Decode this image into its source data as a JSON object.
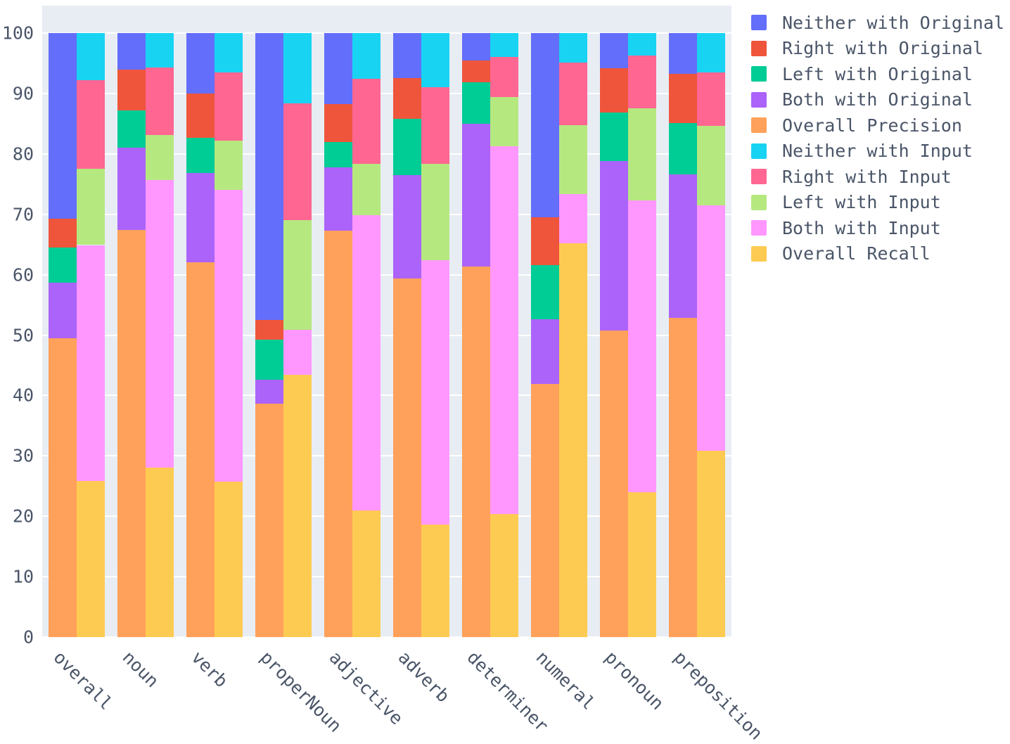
{
  "chart_data": {
    "type": "bar",
    "bar_mode": "stacked-grouped",
    "title": "",
    "xlabel": "",
    "ylabel": "",
    "ylim": [
      0,
      100
    ],
    "ytick_labels": [
      "0",
      "10",
      "20",
      "30",
      "40",
      "50",
      "60",
      "70",
      "80",
      "90",
      "100"
    ],
    "ytick_values": [
      0,
      10,
      20,
      30,
      40,
      50,
      60,
      70,
      80,
      90,
      100
    ],
    "grid": true,
    "legend_position": "right",
    "categories": [
      "overall",
      "noun",
      "verb",
      "properNoun",
      "adjective",
      "adverb",
      "determiner",
      "numeral",
      "pronoun",
      "preposition"
    ],
    "bar_groups": [
      {
        "name": "Original",
        "base_series": "Overall Precision"
      },
      {
        "name": "Input",
        "base_series": "Overall Recall"
      }
    ],
    "series": [
      {
        "name": "Neither with Original",
        "color": "#636efa",
        "stack": "Original",
        "values": [
          30.7,
          6.0,
          10.0,
          47.5,
          11.7,
          7.5,
          4.5,
          30.5,
          5.8,
          6.8
        ]
      },
      {
        "name": "Right with Original",
        "color": "#ef553b",
        "stack": "Original",
        "values": [
          4.8,
          6.8,
          7.4,
          3.3,
          6.4,
          6.7,
          3.6,
          7.9,
          7.3,
          8.1
        ]
      },
      {
        "name": "Left with Original",
        "color": "#00cc96",
        "stack": "Original",
        "values": [
          5.8,
          6.2,
          5.8,
          6.6,
          4.1,
          9.3,
          6.9,
          9.0,
          8.1,
          8.5
        ]
      },
      {
        "name": "Both with Original",
        "color": "#ab63fa",
        "stack": "Original",
        "values": [
          9.2,
          13.6,
          14.7,
          4.0,
          10.5,
          17.1,
          23.6,
          10.7,
          28.0,
          23.7
        ]
      },
      {
        "name": "Overall Precision",
        "color": "#ffa15a",
        "stack": "Original",
        "values": [
          49.5,
          67.4,
          62.1,
          38.6,
          67.3,
          59.4,
          61.4,
          41.9,
          50.8,
          52.9
        ]
      },
      {
        "name": "Neither with Input",
        "color": "#19d3f3",
        "stack": "Input",
        "values": [
          7.8,
          5.7,
          6.5,
          11.6,
          7.6,
          9.0,
          3.9,
          4.9,
          3.7,
          6.5
        ]
      },
      {
        "name": "Right with Input",
        "color": "#ff6692",
        "stack": "Input",
        "values": [
          14.7,
          11.2,
          11.3,
          19.4,
          14.0,
          12.7,
          6.7,
          10.3,
          8.8,
          8.9
        ]
      },
      {
        "name": "Left with Input",
        "color": "#b6e880",
        "stack": "Input",
        "values": [
          12.6,
          7.4,
          8.2,
          18.1,
          8.6,
          15.9,
          8.2,
          11.5,
          15.2,
          13.1
        ]
      },
      {
        "name": "Both with Input",
        "color": "#ff97ff",
        "stack": "Input",
        "values": [
          39.1,
          47.6,
          48.3,
          7.5,
          48.9,
          43.8,
          60.8,
          8.1,
          48.3,
          40.6
        ]
      },
      {
        "name": "Overall Recall",
        "color": "#fecb52",
        "stack": "Input",
        "values": [
          25.8,
          28.1,
          25.7,
          43.4,
          20.9,
          18.6,
          20.4,
          65.2,
          24.0,
          30.9
        ]
      }
    ],
    "legend_entries": [
      {
        "label": "Neither with Original",
        "color": "#636efa"
      },
      {
        "label": "Right with Original",
        "color": "#ef553b"
      },
      {
        "label": "Left with Original",
        "color": "#00cc96"
      },
      {
        "label": "Both with Original",
        "color": "#ab63fa"
      },
      {
        "label": "Overall Precision",
        "color": "#ffa15a"
      },
      {
        "label": "Neither with Input",
        "color": "#19d3f3"
      },
      {
        "label": "Right with Input",
        "color": "#ff6692"
      },
      {
        "label": "Left with Input",
        "color": "#b6e880"
      },
      {
        "label": "Both with Input",
        "color": "#ff97ff"
      },
      {
        "label": "Overall Recall",
        "color": "#fecb52"
      }
    ],
    "plot_background": "#e8edf4",
    "grid_color": "#ffffff",
    "tick_text_color": "#4a5568"
  }
}
